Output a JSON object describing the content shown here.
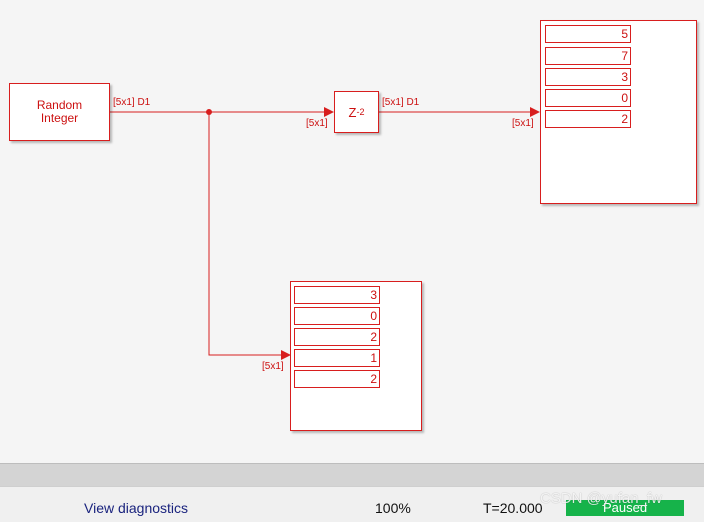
{
  "blocks": {
    "random_integer": {
      "line1": "Random",
      "line2": "Integer"
    },
    "delay": {
      "base": "Z",
      "exponent": "-2"
    },
    "display_top": {
      "values": [
        "5",
        "7",
        "3",
        "0",
        "2"
      ]
    },
    "display_bottom": {
      "values": [
        "3",
        "0",
        "2",
        "1",
        "2"
      ]
    }
  },
  "signals": {
    "src_out": "[5x1] D1",
    "delay_in": "[5x1]",
    "delay_out": "[5x1] D1",
    "display_top_in": "[5x1]",
    "display_bottom_in": "[5x1]"
  },
  "status": {
    "diagnostics_link": "View diagnostics",
    "zoom": "100%",
    "time": "T=20.000",
    "state": "Paused"
  },
  "watermark": "CSDN @yufan_fw",
  "colors": {
    "block": "#d81e1e",
    "paused": "#16b34a",
    "link": "#1a237e"
  }
}
